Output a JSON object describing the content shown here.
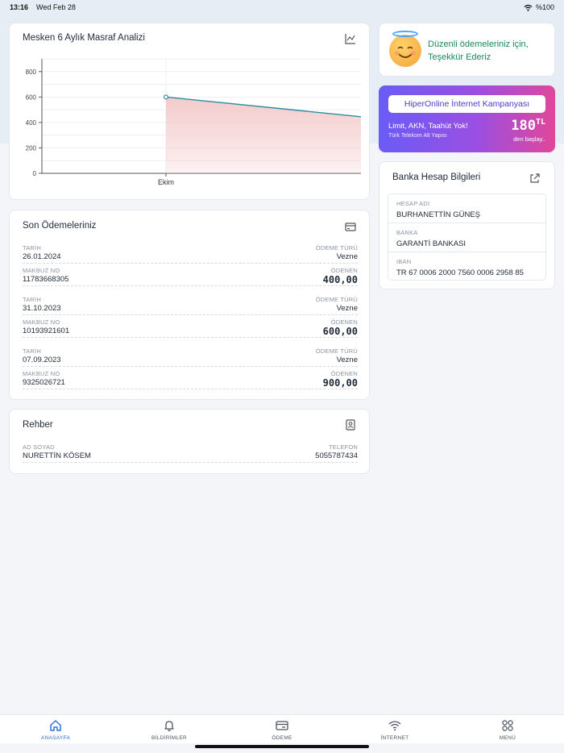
{
  "status_bar": {
    "time": "13:16",
    "date": "Wed Feb 28",
    "battery": "%100"
  },
  "chart_card": {
    "title": "Mesken 6 Aylık Masraf Analizi",
    "icon": "line-chart-icon"
  },
  "chart_data": {
    "type": "area",
    "categories": [
      "Ekim"
    ],
    "x_tick_labels": [
      "Ekim"
    ],
    "values": [
      600,
      445
    ],
    "y_ticks": [
      0,
      200,
      400,
      600,
      800
    ],
    "ylim": [
      0,
      900
    ],
    "series": [
      {
        "values": [
          600,
          445
        ],
        "color": "#2a8ea0"
      }
    ],
    "grid": true,
    "title": "",
    "xlabel": "",
    "ylabel": ""
  },
  "payments": {
    "title": "Son Ödemeleriniz",
    "icon": "card-icon",
    "labels": {
      "date": "TARİH",
      "type": "ÖDEME TÜRÜ",
      "receipt": "MAKBUZ NO",
      "paid": "ÖDENEN"
    },
    "items": [
      {
        "date": "26.01.2024",
        "type": "Vezne",
        "receipt": "11783668305",
        "amount": "400,00"
      },
      {
        "date": "31.10.2023",
        "type": "Vezne",
        "receipt": "10193921601",
        "amount": "600,00"
      },
      {
        "date": "07.09.2023",
        "type": "Vezne",
        "receipt": "9325026721",
        "amount": "900,00"
      }
    ]
  },
  "guide": {
    "title": "Rehber",
    "icon": "contacts-icon",
    "labels": {
      "name": "AD SOYAD",
      "phone": "TELEFON"
    },
    "name": "NURETTİN KÖSEM",
    "phone": "5055787434"
  },
  "thanks": {
    "line1": "Düzenli ödemeleriniz için,",
    "line2": "Teşekkür Ederiz"
  },
  "promo": {
    "title": "HiperOnline İnternet Kampanyası",
    "subtitle": "Limit, AKN, Taahüt Yok!",
    "subtitle2": "Türk Telekom Alt Yapısı",
    "price": "180",
    "unit": "TL",
    "from": "den başlay.."
  },
  "bank": {
    "title": "Banka Hesap Bilgileri",
    "icon": "share-icon",
    "rows": [
      {
        "label": "HESAP ADI",
        "value": "BURHANETTİN GÜNEŞ"
      },
      {
        "label": "BANKA",
        "value": "GARANTİ BANKASI"
      },
      {
        "label": "IBAN",
        "value": "TR 67 0006 2000 7560 0006 2958 85"
      }
    ]
  },
  "tabbar": [
    {
      "label": "ANASAYFA",
      "icon": "home-icon",
      "active": true
    },
    {
      "label": "BİLDİRİMLER",
      "icon": "bell-icon",
      "active": false
    },
    {
      "label": "ÖDEME",
      "icon": "payment-card-icon",
      "active": false
    },
    {
      "label": "İNTERNET",
      "icon": "wifi-icon",
      "active": false
    },
    {
      "label": "MENÜ",
      "icon": "grid-menu-icon",
      "active": false
    }
  ],
  "colors": {
    "accent": "#2a72d8",
    "chart_line": "#2a8ea0",
    "chart_fill": "#f3c8c8",
    "success_text": "#1a8a5a"
  }
}
